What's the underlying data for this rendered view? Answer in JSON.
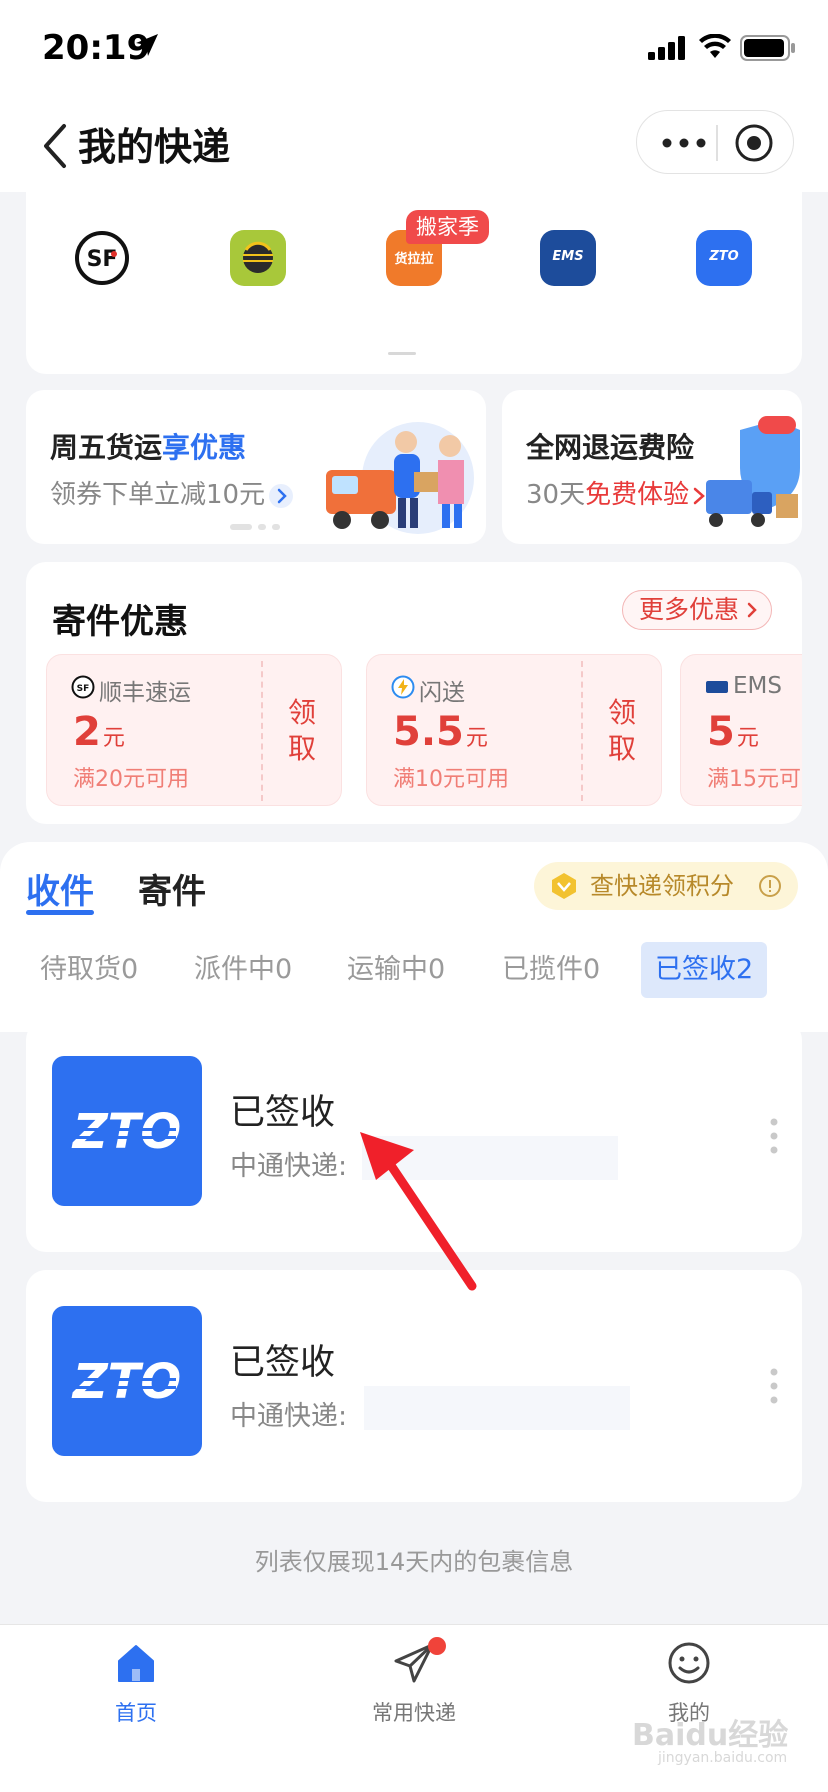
{
  "status_bar": {
    "time": "20:19"
  },
  "nav": {
    "title": "我的快递"
  },
  "carriers": {
    "items": [
      {
        "name": "sf-express",
        "label": "SF"
      },
      {
        "name": "yto",
        "label": ""
      },
      {
        "name": "huolala",
        "label": "货拉拉"
      },
      {
        "name": "ems",
        "label": "EMS"
      },
      {
        "name": "zto",
        "label": "ZTO"
      }
    ],
    "badge": "搬家季"
  },
  "promos": [
    {
      "title_prefix": "周五货运",
      "title_highlight": "享优惠",
      "subtitle": "领券下单立减10元"
    },
    {
      "title": "全网退运费险",
      "subtitle_prefix": "30天",
      "subtitle_highlight": "免费体验"
    }
  ],
  "coupons": {
    "title": "寄件优惠",
    "more_label": "更多优惠",
    "items": [
      {
        "carrier": "顺丰速运",
        "amount": "2",
        "unit": "元",
        "condition": "满20元可用",
        "claim": "领取"
      },
      {
        "carrier": "闪送",
        "amount": "5.5",
        "unit": "元",
        "condition": "满10元可用",
        "claim": "领取"
      },
      {
        "carrier": "EMS",
        "amount": "5",
        "unit": "元",
        "condition": "满15元可",
        "claim": ""
      }
    ]
  },
  "tracking": {
    "tabs": [
      "收件",
      "寄件"
    ],
    "points_label": "查快递领积分",
    "status_tabs": [
      "待取货0",
      "派件中0",
      "运输中0",
      "已揽件0",
      "已签收2"
    ],
    "packages": [
      {
        "status": "已签收",
        "company": "中通快递:"
      },
      {
        "status": "已签收",
        "company": "中通快递: "
      }
    ],
    "footnote": "列表仅展现14天内的包裹信息"
  },
  "tabbar": [
    {
      "label": "首页"
    },
    {
      "label": "常用快递"
    },
    {
      "label": "我的"
    }
  ],
  "watermark": "Baidu经验",
  "watermark_url": "jingyan.baidu.com",
  "colors": {
    "accent": "#2d70f0",
    "red": "#e0403a"
  }
}
